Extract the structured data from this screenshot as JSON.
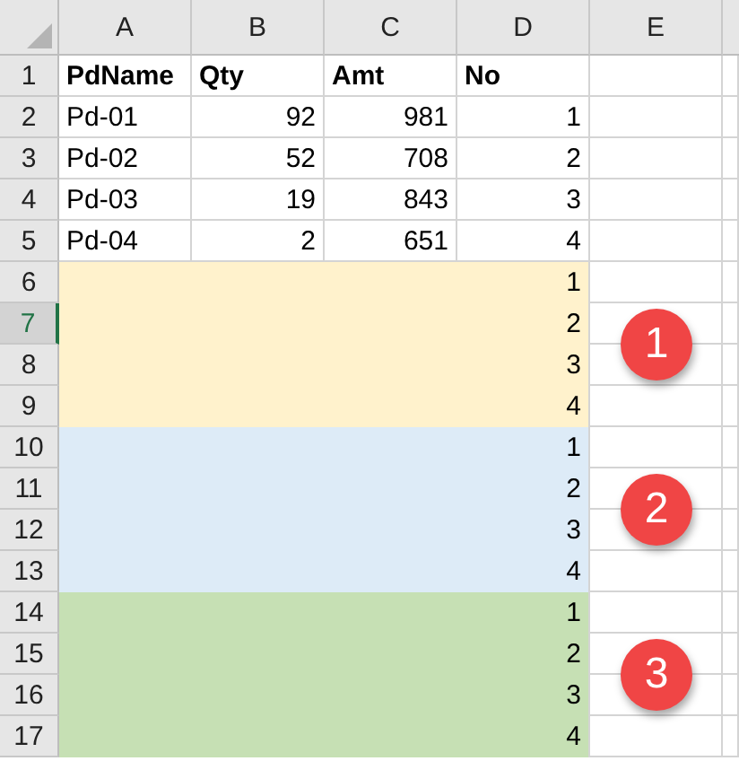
{
  "column_headers": [
    "A",
    "B",
    "C",
    "D",
    "E"
  ],
  "rows": [
    {
      "number": "1",
      "selected": false,
      "kind": "header",
      "cells": [
        "PdName",
        "Qty",
        "Amt",
        "No"
      ]
    },
    {
      "number": "2",
      "selected": false,
      "kind": "data",
      "cells": [
        "Pd-01",
        "92",
        "981",
        "1"
      ]
    },
    {
      "number": "3",
      "selected": false,
      "kind": "data",
      "cells": [
        "Pd-02",
        "52",
        "708",
        "2"
      ]
    },
    {
      "number": "4",
      "selected": false,
      "kind": "data",
      "cells": [
        "Pd-03",
        "19",
        "843",
        "3"
      ]
    },
    {
      "number": "5",
      "selected": false,
      "kind": "data",
      "cells": [
        "Pd-04",
        "2",
        "651",
        "4"
      ]
    }
  ],
  "bands": [
    {
      "badge": "1",
      "color": "#fff2cc",
      "rows": [
        {
          "number": "6",
          "selected": false,
          "no": "1"
        },
        {
          "number": "7",
          "selected": true,
          "no": "2"
        },
        {
          "number": "8",
          "selected": false,
          "no": "3"
        },
        {
          "number": "9",
          "selected": false,
          "no": "4"
        }
      ]
    },
    {
      "badge": "2",
      "color": "#ddebf7",
      "rows": [
        {
          "number": "10",
          "selected": false,
          "no": "1"
        },
        {
          "number": "11",
          "selected": false,
          "no": "2"
        },
        {
          "number": "12",
          "selected": false,
          "no": "3"
        },
        {
          "number": "13",
          "selected": false,
          "no": "4"
        }
      ]
    },
    {
      "badge": "3",
      "color": "#c6e0b4",
      "rows": [
        {
          "number": "14",
          "selected": false,
          "no": "1"
        },
        {
          "number": "15",
          "selected": false,
          "no": "2"
        },
        {
          "number": "16",
          "selected": false,
          "no": "3"
        },
        {
          "number": "17",
          "selected": false,
          "no": "4"
        }
      ]
    }
  ]
}
